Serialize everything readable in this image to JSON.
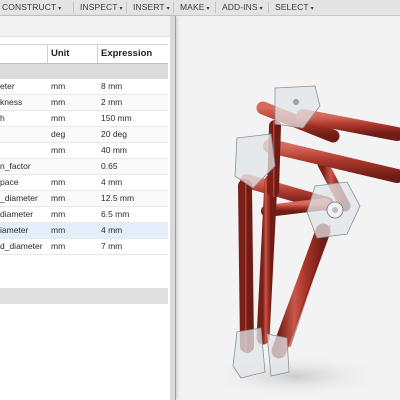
{
  "toolbar": {
    "menus": [
      {
        "label": "CONSTRUCT",
        "name": "menu-construct"
      },
      {
        "label": "INSPECT",
        "name": "menu-inspect"
      },
      {
        "label": "INSERT",
        "name": "menu-insert"
      },
      {
        "label": "MAKE",
        "name": "menu-make"
      },
      {
        "label": "ADD-INS",
        "name": "menu-add-ins"
      },
      {
        "label": "SELECT",
        "name": "menu-select"
      }
    ],
    "caret": "▾"
  },
  "parameters": {
    "columns": {
      "name": "",
      "unit": "Unit",
      "expression": "Expression"
    },
    "rows": [
      {
        "name": "eter",
        "unit": "mm",
        "expression": "8 mm"
      },
      {
        "name": "kness",
        "unit": "mm",
        "expression": "2 mm"
      },
      {
        "name": "h",
        "unit": "mm",
        "expression": "150 mm"
      },
      {
        "name": "",
        "unit": "deg",
        "expression": "20 deg"
      },
      {
        "name": "",
        "unit": "mm",
        "expression": "40 mm"
      },
      {
        "name": "n_factor",
        "unit": "",
        "expression": "0.65"
      },
      {
        "name": "pace",
        "unit": "mm",
        "expression": "4 mm"
      },
      {
        "name": "_diameter",
        "unit": "mm",
        "expression": "12.5 mm"
      },
      {
        "name": "diameter",
        "unit": "mm",
        "expression": "6.5 mm"
      },
      {
        "name": "iameter",
        "unit": "mm",
        "expression": "4 mm"
      },
      {
        "name": "d_diameter",
        "unit": "mm",
        "expression": "7 mm"
      }
    ],
    "selected_row": 9
  },
  "colors": {
    "rod": "#b03a2e",
    "rod_highlight": "#d86a5c",
    "rod_shadow": "#7a2018",
    "connector": "#d8dde3",
    "viewport_bg": "#f3f3f3"
  }
}
